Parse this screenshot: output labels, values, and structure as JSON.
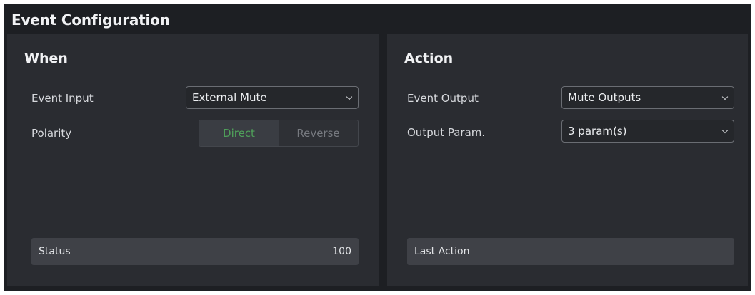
{
  "window": {
    "title": "Event Configuration"
  },
  "when": {
    "title": "When",
    "event_input": {
      "label": "Event Input",
      "value": "External Mute"
    },
    "polarity": {
      "label": "Polarity",
      "options": [
        "Direct",
        "Reverse"
      ],
      "selected": "Direct"
    },
    "status": {
      "label": "Status",
      "value": "100"
    }
  },
  "action": {
    "title": "Action",
    "event_output": {
      "label": "Event Output",
      "value": "Mute Outputs"
    },
    "output_param": {
      "label": "Output Param.",
      "value": "3 param(s)"
    },
    "last_action": {
      "label": "Last Action",
      "value": ""
    }
  },
  "colors": {
    "background": "#1d1f23",
    "panel": "#2a2c31",
    "active_option": "#4fa05a",
    "status_bar": "#3f4147"
  },
  "icons": [
    "chevron-down-icon"
  ]
}
